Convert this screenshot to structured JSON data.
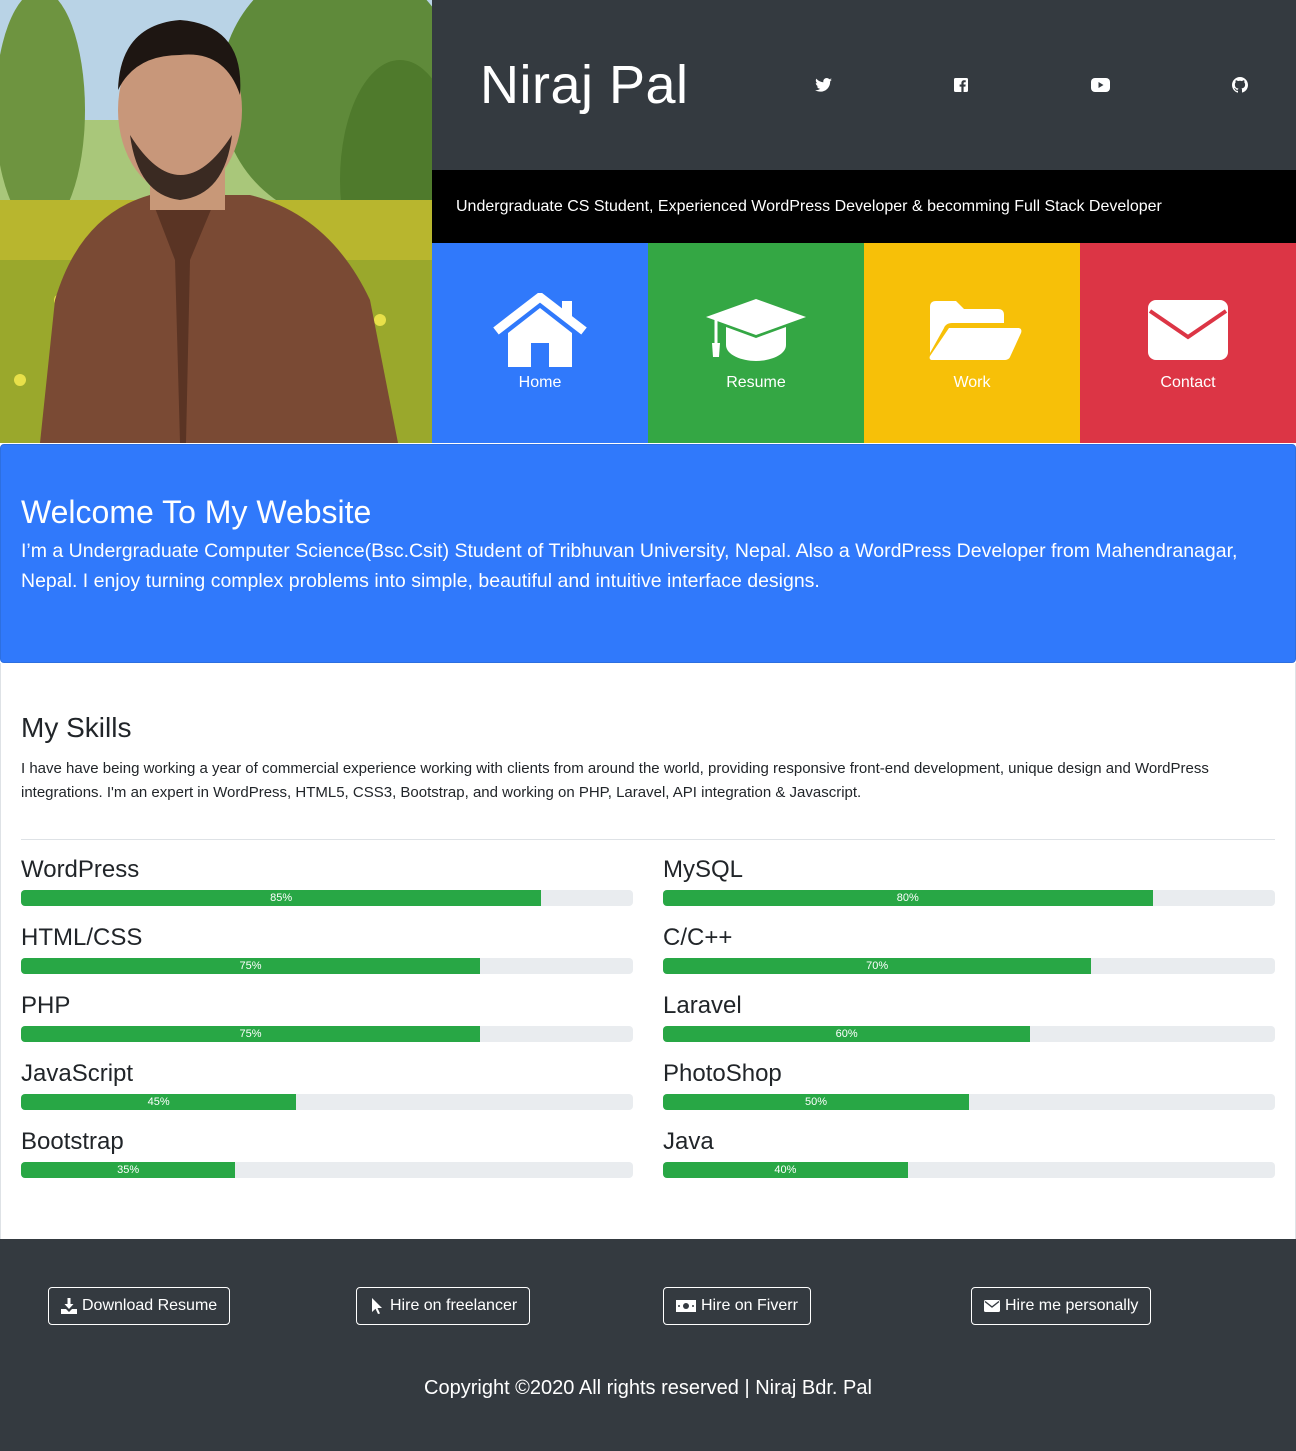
{
  "header": {
    "name": "Niraj Pal",
    "tagline": "Undergraduate CS Student, Experienced WordPress Developer & becomming Full Stack Developer",
    "social": [
      "twitter-icon",
      "facebook-icon",
      "youtube-icon",
      "github-icon"
    ]
  },
  "nav": {
    "tiles": [
      {
        "label": "Home",
        "icon": "home-icon",
        "color": "#3079fb"
      },
      {
        "label": "Resume",
        "icon": "graduation-cap-icon",
        "color": "#34a744"
      },
      {
        "label": "Work",
        "icon": "folder-open-icon",
        "color": "#f7c008"
      },
      {
        "label": "Contact",
        "icon": "envelope-icon",
        "color": "#dc3545"
      }
    ]
  },
  "welcome": {
    "title": "Welcome To My Website",
    "text": "I’m a Undergraduate Computer Science(Bsc.Csit) Student of Tribhuvan University, Nepal. Also a WordPress Developer from Mahendranagar, Nepal. I enjoy turning complex problems into simple, beautiful and intuitive interface designs."
  },
  "skills": {
    "title": "My Skills",
    "intro": "I have have being working a year of commercial experience working with clients from around the world, providing responsive front-end development, unique design and WordPress integrations. I'm an expert in WordPress, HTML5, CSS3, Bootstrap, and working on PHP, Laravel, API integration & Javascript.",
    "left": [
      {
        "name": "WordPress",
        "percent": 85,
        "label": "85%"
      },
      {
        "name": "HTML/CSS",
        "percent": 75,
        "label": "75%"
      },
      {
        "name": "PHP",
        "percent": 75,
        "label": "75%"
      },
      {
        "name": "JavaScript",
        "percent": 45,
        "label": "45%"
      },
      {
        "name": "Bootstrap",
        "percent": 35,
        "label": "35%"
      }
    ],
    "right": [
      {
        "name": "MySQL",
        "percent": 80,
        "label": "80%"
      },
      {
        "name": "C/C++",
        "percent": 70,
        "label": "70%"
      },
      {
        "name": "Laravel",
        "percent": 60,
        "label": "60%"
      },
      {
        "name": "PhotoShop",
        "percent": 50,
        "label": "50%"
      },
      {
        "name": "Java",
        "percent": 40,
        "label": "40%"
      }
    ]
  },
  "footer": {
    "buttons": [
      {
        "label": "Download Resume",
        "icon": "download-icon"
      },
      {
        "label": "Hire on freelancer",
        "icon": "cursor-icon"
      },
      {
        "label": "Hire on Fiverr",
        "icon": "money-icon"
      },
      {
        "label": "Hire me personally",
        "icon": "envelope-icon"
      }
    ],
    "copyright": "Copyright ©2020 All rights reserved | Niraj Bdr. Pal"
  }
}
